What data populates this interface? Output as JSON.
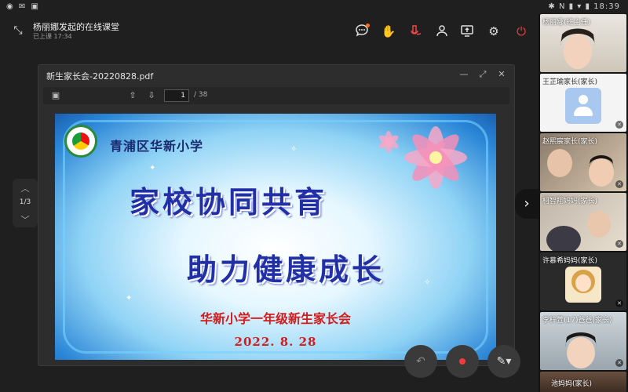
{
  "status_bar": {
    "left_icons": "◉ ✉ ▣",
    "right_text": "✱ N ▮ ▾ ▮ 18:39"
  },
  "meeting": {
    "title": "杨丽娜发起的在线课堂",
    "subtitle": "已上课 17:34"
  },
  "toolbar_icons": [
    "chat-icon",
    "raise-hand-icon",
    "audio-icon",
    "member-icon",
    "share-screen-icon",
    "settings-icon",
    "end-call-icon"
  ],
  "document": {
    "filename": "新生家长会-20220828.pdf",
    "page_current": "1",
    "page_total": "/ 38"
  },
  "slide": {
    "school_name": "青浦区华新小学",
    "headline_1": "家校协同共育",
    "headline_2": "助力健康成长",
    "caption": "华新小学一年级新生家长会",
    "date": "2022. 8. 28"
  },
  "page_nav": {
    "label": "1/3"
  },
  "participants": [
    {
      "name": "杨丽娜(班主任)",
      "type": "video"
    },
    {
      "name": "王芷瑜家长(家长)",
      "type": "placeholder"
    },
    {
      "name": "赵熙宸家长(家长)",
      "type": "video"
    },
    {
      "name": "柯智翔妈妈(家长)",
      "type": "video"
    },
    {
      "name": "许慕希妈妈(家长)",
      "type": "cartoon"
    },
    {
      "name": "李梓萱(17)爸爸(家长)",
      "type": "video"
    },
    {
      "name": "池妈妈(家长)",
      "type": "video"
    }
  ],
  "colors": {
    "end_call": "#ef4444",
    "record": "#ef3b3b",
    "slide_title": "#2230a8",
    "slide_red": "#d41a1a"
  }
}
